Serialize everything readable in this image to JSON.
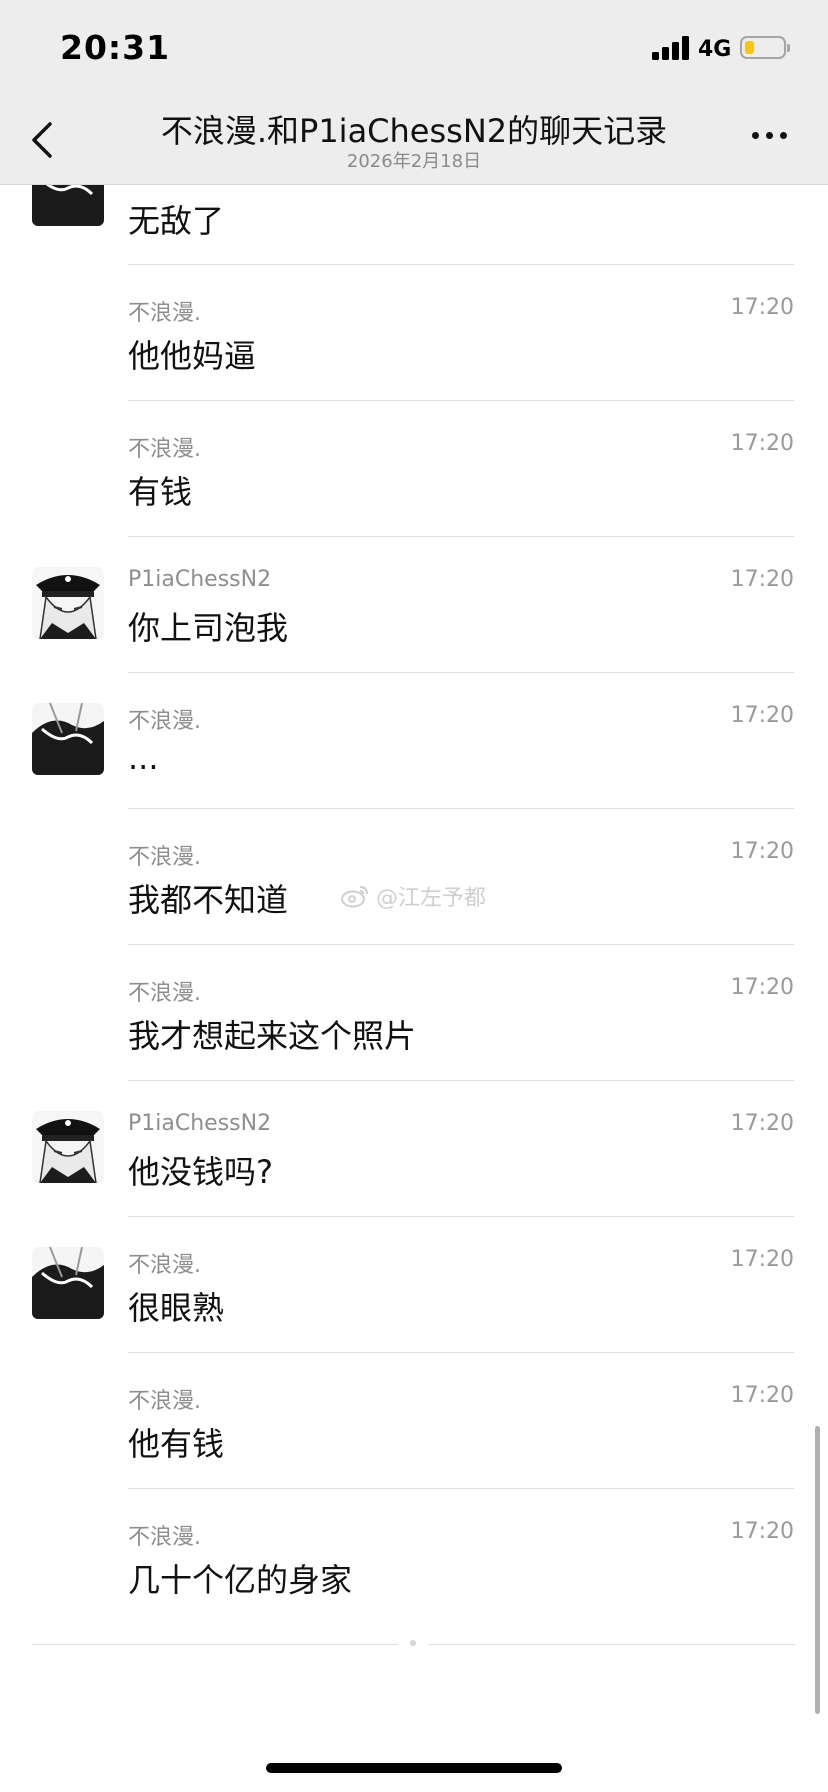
{
  "status_bar": {
    "time": "20:31",
    "network": "4G",
    "signal_bars": 4,
    "battery_level": 0.25,
    "battery_color": "#f5c518"
  },
  "nav": {
    "back_icon": "chevron-left-icon",
    "title": "不浪漫.和P1iaChessN2的聊天记录",
    "subtitle": "2026年2月18日",
    "more_icon": "more-dots-icon"
  },
  "messages": [
    {
      "sender": "",
      "time": "",
      "text": "无敌了",
      "avatar": "avatar-anime-a"
    },
    {
      "sender": "不浪漫.",
      "time": "17:20",
      "text": "他他妈逼",
      "avatar": ""
    },
    {
      "sender": "不浪漫.",
      "time": "17:20",
      "text": "有钱",
      "avatar": ""
    },
    {
      "sender": "P1iaChessN2",
      "time": "17:20",
      "text": "你上司泡我",
      "avatar": "avatar-anime-b"
    },
    {
      "sender": "不浪漫.",
      "time": "17:20",
      "text": "...",
      "avatar": "avatar-anime-a"
    },
    {
      "sender": "不浪漫.",
      "time": "17:20",
      "text": "我都不知道",
      "avatar": ""
    },
    {
      "sender": "不浪漫.",
      "time": "17:20",
      "text": "我才想起来这个照片",
      "avatar": ""
    },
    {
      "sender": "P1iaChessN2",
      "time": "17:20",
      "text": "他没钱吗?",
      "avatar": "avatar-anime-b"
    },
    {
      "sender": "不浪漫.",
      "time": "17:20",
      "text": "很眼熟",
      "avatar": "avatar-anime-a"
    },
    {
      "sender": "不浪漫.",
      "time": "17:20",
      "text": "他有钱",
      "avatar": ""
    },
    {
      "sender": "不浪漫.",
      "time": "17:20",
      "text": "几十个亿的身家",
      "avatar": ""
    }
  ],
  "watermark": {
    "text": "@江左予都",
    "icon": "weibo-icon"
  },
  "colors": {
    "header_bg": "#ededed",
    "text_primary": "#111111",
    "text_secondary": "#8e8e8e",
    "divider": "#dedede"
  }
}
